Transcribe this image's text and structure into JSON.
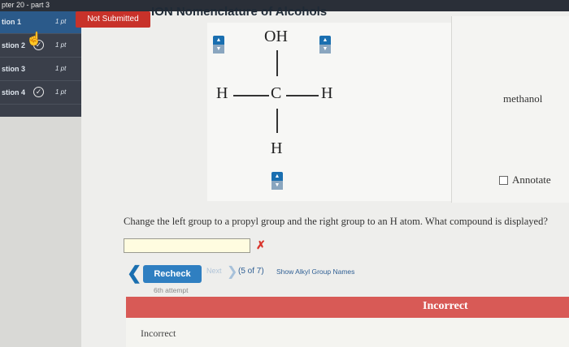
{
  "header": {
    "chapter_label": "pter 20 - part 3"
  },
  "sidebar": {
    "items": [
      {
        "label": "tion 1",
        "points": "1 pt",
        "completed": false,
        "active": true
      },
      {
        "label": "stion 2",
        "points": "1 pt",
        "completed": true,
        "active": false
      },
      {
        "label": "stion 3",
        "points": "1 pt",
        "completed": false,
        "active": false
      },
      {
        "label": "stion 4",
        "points": "1 pt",
        "completed": true,
        "active": false
      }
    ]
  },
  "status_badge": {
    "label": "Not Submitted",
    "color": "#c8322a"
  },
  "title": "ION Nomenclature of Alcohols",
  "structure": {
    "top": "OH",
    "left": "H",
    "center": "C",
    "right": "H",
    "bottom": "H"
  },
  "icons": {
    "stepper": "up-down-stepper-icon",
    "check": "check-circle-icon",
    "cursor": "hand-cursor-icon",
    "back": "chevron-left-icon",
    "next": "chevron-right-icon",
    "wrong": "x-mark-icon"
  },
  "compound_name": "methanol",
  "annotate_label": "Annotate",
  "question_text": "Change the left group to a propyl group and the right group to an H atom. What compound is displayed?",
  "answer": {
    "value": "",
    "placeholder": ""
  },
  "wrong_mark": "✗",
  "controls": {
    "recheck_label": "Recheck",
    "next_label": "Next",
    "counter": "(5 of 7)",
    "show_alkyl_label": "Show Alkyl Group Names",
    "attempt_label": "6th attempt"
  },
  "result": {
    "banner": "Incorrect",
    "feedback": "Incorrect",
    "color": "#d85a56"
  }
}
